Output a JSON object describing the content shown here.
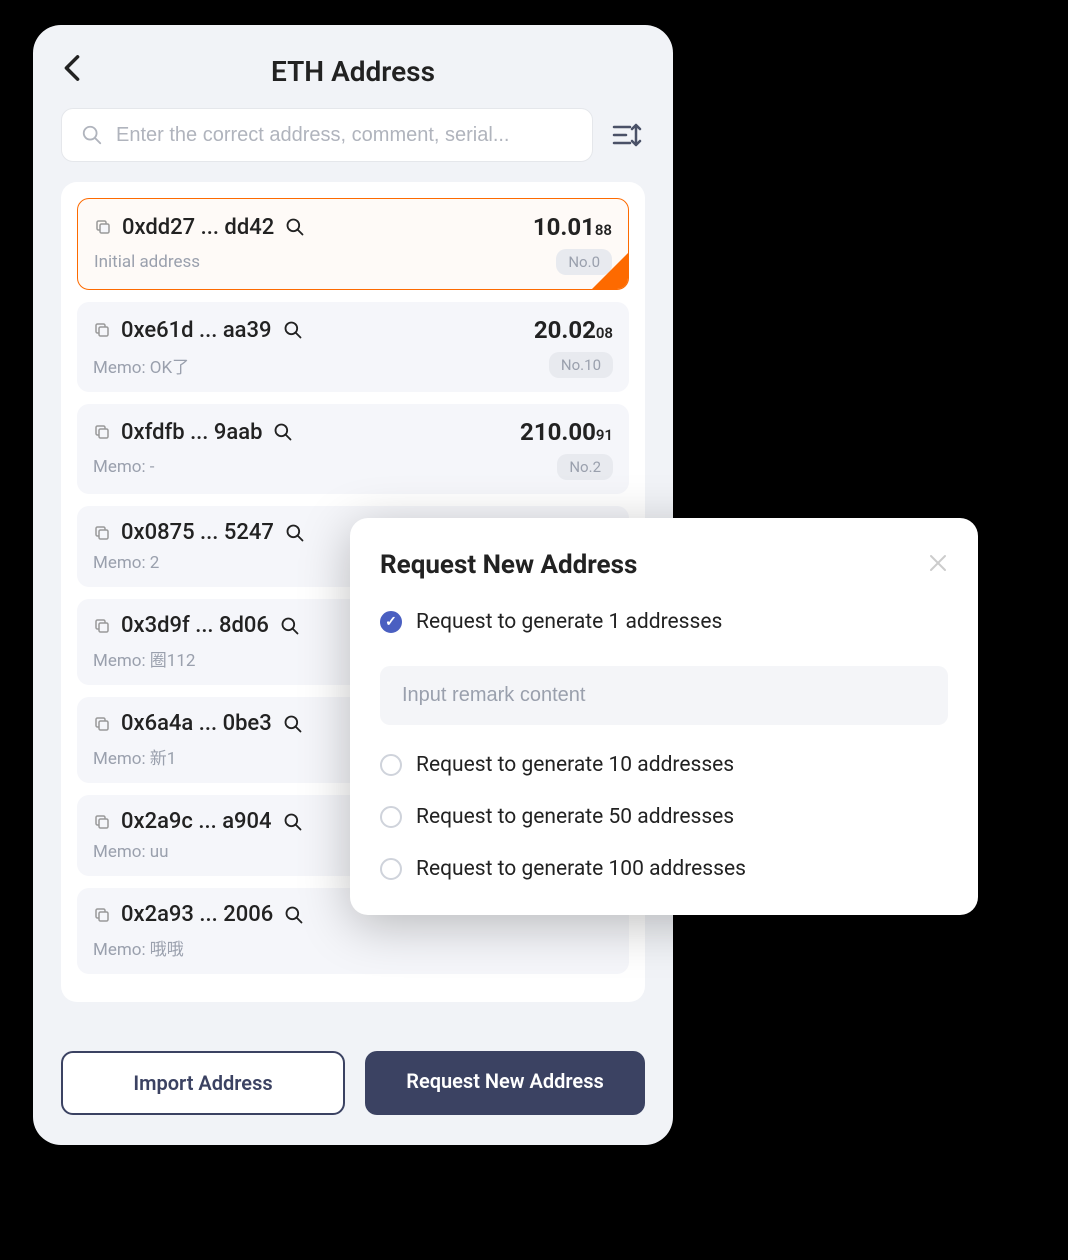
{
  "header": {
    "title": "ETH Address"
  },
  "search": {
    "placeholder": "Enter the correct address, comment, serial..."
  },
  "addresses": [
    {
      "addr": "0xdd27 ... dd42",
      "balance": "10.01",
      "balance_sub": "88",
      "memo": "Initial address",
      "no": "No.0",
      "selected": true
    },
    {
      "addr": "0xe61d ... aa39",
      "balance": "20.02",
      "balance_sub": "08",
      "memo": "Memo: OK了",
      "no": "No.10",
      "selected": false
    },
    {
      "addr": "0xfdfb ... 9aab",
      "balance": "210.00",
      "balance_sub": "91",
      "memo": "Memo: -",
      "no": "No.2",
      "selected": false
    },
    {
      "addr": "0x0875 ... 5247",
      "balance": "",
      "balance_sub": "",
      "memo": "Memo: 2",
      "no": "",
      "selected": false
    },
    {
      "addr": "0x3d9f ... 8d06",
      "balance": "",
      "balance_sub": "",
      "memo": "Memo: 圈112",
      "no": "",
      "selected": false
    },
    {
      "addr": "0x6a4a ... 0be3",
      "balance": "",
      "balance_sub": "",
      "memo": "Memo: 新1",
      "no": "",
      "selected": false
    },
    {
      "addr": "0x2a9c ... a904",
      "balance": "",
      "balance_sub": "",
      "memo": "Memo: uu",
      "no": "",
      "selected": false
    },
    {
      "addr": "0x2a93 ... 2006",
      "balance": "",
      "balance_sub": "",
      "memo": "Memo: 哦哦",
      "no": "",
      "selected": false
    }
  ],
  "footer": {
    "import_label": "Import Address",
    "request_label": "Request New Address"
  },
  "modal": {
    "title": "Request New Address",
    "remark_placeholder": "Input remark content",
    "options": [
      {
        "label": "Request to generate 1 addresses",
        "checked": true
      },
      {
        "label": "Request to generate 10 addresses",
        "checked": false
      },
      {
        "label": "Request to generate 50 addresses",
        "checked": false
      },
      {
        "label": "Request to generate 100 addresses",
        "checked": false
      }
    ]
  }
}
